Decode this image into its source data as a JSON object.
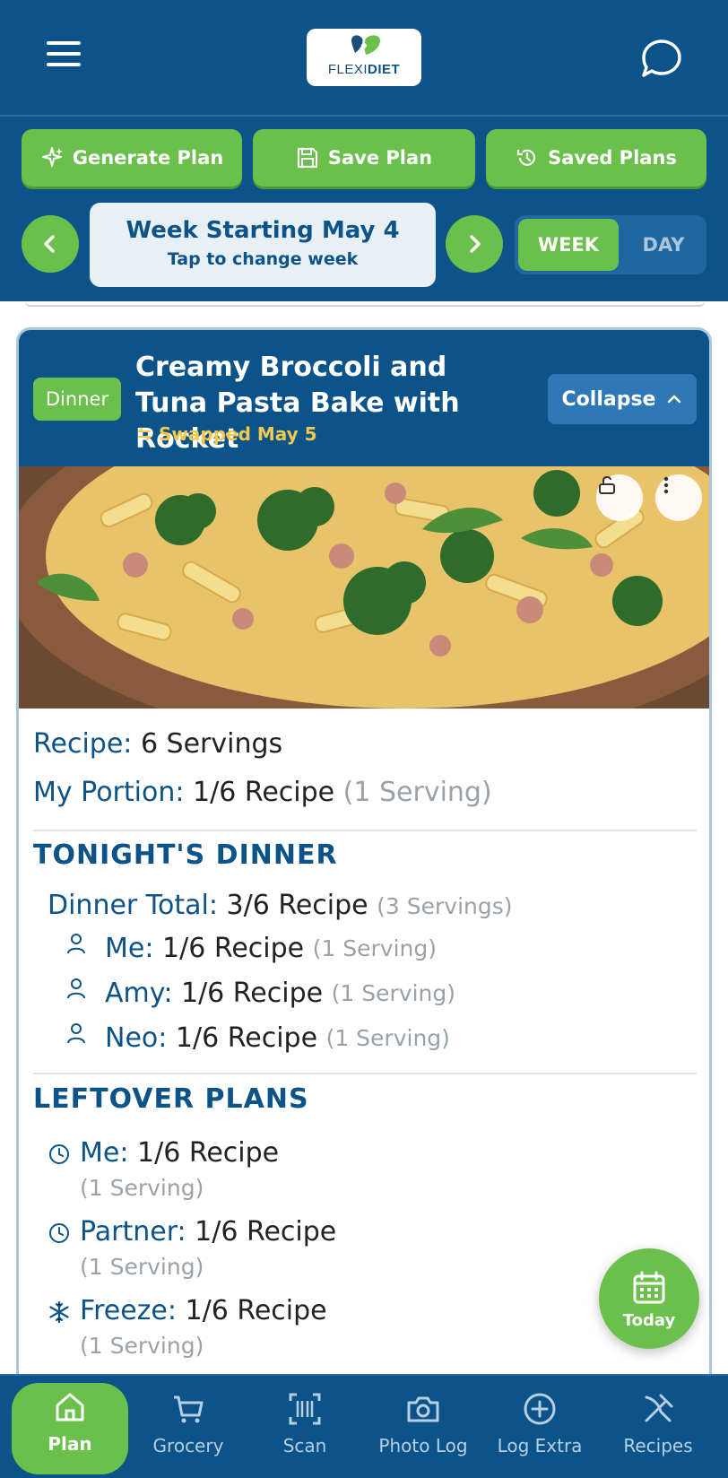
{
  "header": {
    "logo_text_light": "FLEXI",
    "logo_text_bold": "DIET"
  },
  "toolbar": {
    "generate_label": "Generate Plan",
    "save_label": "Save Plan",
    "saved_label": "Saved Plans"
  },
  "week_nav": {
    "title": "Week Starting May 4",
    "subtitle": "Tap to change week",
    "view_week": "WEEK",
    "view_day": "DAY",
    "active_view": "WEEK"
  },
  "meal": {
    "badge": "Dinner",
    "title": "Creamy Broccoli and Tuna Pasta Bake with Rocket",
    "swap_note": "Swapped May 5",
    "collapse_label": "Collapse",
    "recipe_label": "Recipe:",
    "recipe_value": "6 Servings",
    "portion_label": "My Portion:",
    "portion_value": "1/6 Recipe",
    "portion_note": "(1 Serving)"
  },
  "tonight": {
    "heading": "TONIGHT'S DINNER",
    "total_label": "Dinner Total:",
    "total_value": "3/6 Recipe",
    "total_note": "(3 Servings)",
    "people": [
      {
        "name": "Me:",
        "value": "1/6 Recipe",
        "note": "(1 Serving)"
      },
      {
        "name": "Amy:",
        "value": "1/6 Recipe",
        "note": "(1 Serving)"
      },
      {
        "name": "Neo:",
        "value": "1/6 Recipe",
        "note": "(1 Serving)"
      }
    ]
  },
  "leftovers": {
    "heading": "LEFTOVER PLANS",
    "items": [
      {
        "icon": "clock-icon",
        "name": "Me:",
        "value": "1/6 Recipe",
        "note": "(1 Serving)"
      },
      {
        "icon": "clock-icon",
        "name": "Partner:",
        "value": "1/6 Recipe",
        "note": "(1 Serving)"
      },
      {
        "icon": "snowflake-icon",
        "name": "Freeze:",
        "value": "1/6 Recipe",
        "note": "(1 Serving)"
      }
    ]
  },
  "today_fab": {
    "label": "Today"
  },
  "bottom_nav": {
    "items": [
      {
        "label": "Plan",
        "icon": "home-icon",
        "active": true
      },
      {
        "label": "Grocery",
        "icon": "cart-icon"
      },
      {
        "label": "Scan",
        "icon": "barcode-scan-icon"
      },
      {
        "label": "Photo Log",
        "icon": "camera-icon"
      },
      {
        "label": "Log Extra",
        "icon": "plus-circle-icon"
      },
      {
        "label": "Recipes",
        "icon": "utensils-icon"
      }
    ]
  },
  "colors": {
    "brand_blue": "#0c5389",
    "accent_green": "#6ac04b",
    "swap_yellow": "#f2c94c"
  }
}
